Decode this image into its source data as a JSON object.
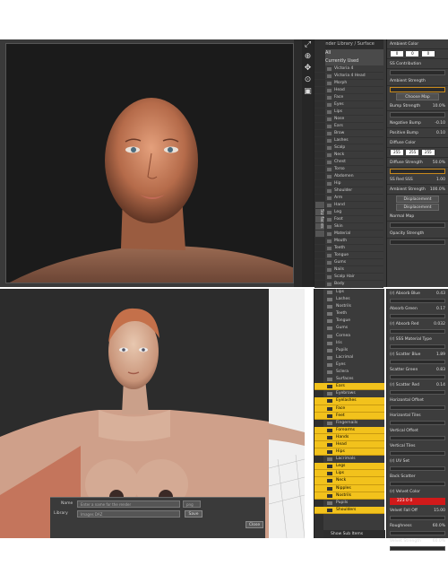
{
  "top": {
    "path": "Render Library / Surface",
    "tools": [
      "⤢",
      "⊕",
      "✥",
      "⊙",
      "▣"
    ],
    "library": {
      "header_all": "All",
      "header_recent": "Currently Used",
      "items": [
        "Victoria 4",
        "Victoria 4 Head",
        "Morph",
        "Head",
        "Face",
        "Eyes",
        "Lips",
        "Nose",
        "Ears",
        "Brow",
        "Lashes",
        "Scalp",
        "Neck",
        "Chest",
        "Torso",
        "Abdomen",
        "Hip",
        "Shoulder",
        "Arm",
        "Hand",
        "Leg",
        "Foot",
        "Skin",
        "Material",
        "Mouth",
        "Teeth",
        "Tongue",
        "Gums",
        "Nails",
        "Scalp Hair",
        "Body",
        "Lacrimal",
        "Cornea",
        "Pupil",
        "Iris",
        "Sclera",
        "Back",
        "Front",
        "Shared"
      ],
      "side_tab": "Surfaces"
    },
    "props": [
      {
        "label": "Ambient Color",
        "value": ""
      },
      {
        "label": "SS Contribution",
        "value": ""
      },
      {
        "label": "Ambient Strength",
        "value": ""
      },
      {
        "label": "Bump Strength",
        "value": "10.0%"
      },
      {
        "label": "Negative Bump",
        "value": "-0.10"
      },
      {
        "label": "Positive Bump",
        "value": "0.10"
      },
      {
        "label": "Diffuse Color",
        "value": ""
      },
      {
        "label": "Diffuse Strength",
        "value": "50.0%"
      },
      {
        "label": "SS Red SSS",
        "value": "1.00"
      },
      {
        "label": "Ambient Strength",
        "value": "100.0%"
      },
      {
        "label": "Displacement",
        "value": ""
      },
      {
        "label": "Displacement",
        "value": ""
      },
      {
        "label": "Normal Map",
        "value": ""
      },
      {
        "label": "Opacity Strength",
        "value": ""
      }
    ],
    "button_label": "Choose Map",
    "swatch_values": [
      "0",
      "0",
      "0"
    ],
    "diffuse_swatch": [
      "255",
      "255",
      "255"
    ]
  },
  "bottom": {
    "library": {
      "items": [
        {
          "label": "Lips",
          "hl": false
        },
        {
          "label": "Lashes",
          "hl": false
        },
        {
          "label": "Nostrils",
          "hl": false
        },
        {
          "label": "Teeth",
          "hl": false
        },
        {
          "label": "Tongue",
          "hl": false
        },
        {
          "label": "Gums",
          "hl": false
        },
        {
          "label": "Cornea",
          "hl": false
        },
        {
          "label": "Iris",
          "hl": false
        },
        {
          "label": "Pupils",
          "hl": false
        },
        {
          "label": "Lacrimal",
          "hl": false
        },
        {
          "label": "Eyes",
          "hl": false
        },
        {
          "label": "Sclera",
          "hl": false
        },
        {
          "label": "Surfaces",
          "hl": false
        },
        {
          "label": "Ears",
          "hl": true
        },
        {
          "label": "Eyebrows",
          "hl": false
        },
        {
          "label": "Eyelashes",
          "hl": true
        },
        {
          "label": "Face",
          "hl": true
        },
        {
          "label": "Feet",
          "hl": true
        },
        {
          "label": "Fingernails",
          "hl": false
        },
        {
          "label": "Forearms",
          "hl": true
        },
        {
          "label": "Hands",
          "hl": true
        },
        {
          "label": "Head",
          "hl": true
        },
        {
          "label": "Hips",
          "hl": true
        },
        {
          "label": "Lacrimals",
          "hl": false
        },
        {
          "label": "Legs",
          "hl": true
        },
        {
          "label": "Lips",
          "hl": true
        },
        {
          "label": "Neck",
          "hl": true
        },
        {
          "label": "Nipples",
          "hl": true
        },
        {
          "label": "Nostrils",
          "hl": true
        },
        {
          "label": "Pupils",
          "hl": false
        },
        {
          "label": "Shoulders",
          "hl": true
        }
      ],
      "footer": "Show Sub Items"
    },
    "props": [
      {
        "label": "(r) Absorb Blue",
        "value": "0.43"
      },
      {
        "label": "Absorb Green",
        "value": "0.17"
      },
      {
        "label": "(r) Absorb Red",
        "value": "0.032"
      },
      {
        "label": "(r) SSS Material Type",
        "value": ""
      },
      {
        "label": "(r) Scatter Blue",
        "value": "1.89"
      },
      {
        "label": "Scatter Green",
        "value": "0.83"
      },
      {
        "label": "(r) Scatter Red",
        "value": "0.14"
      },
      {
        "label": "Horizontal Offset",
        "value": ""
      },
      {
        "label": "Horizontal Tiles",
        "value": ""
      },
      {
        "label": "Vertical Offset",
        "value": ""
      },
      {
        "label": "Vertical Tiles",
        "value": ""
      },
      {
        "label": "(r) UV Set",
        "value": ""
      },
      {
        "label": "Back Scatter",
        "value": ""
      },
      {
        "label": "(r) Velvet Color",
        "value": ""
      },
      {
        "label": "Velvet Fall Off",
        "value": "15.00"
      },
      {
        "label": "Roughness",
        "value": "60.0%"
      },
      {
        "label": "Velvet Strength",
        "value": "60.0%"
      }
    ],
    "red_swatch": "223  0  0",
    "dialog": {
      "name_label": "Name",
      "name_placeholder": "Enter a name for the render",
      "format": "png",
      "library_label": "Library",
      "library_value": "Images DAZ",
      "save_label": "Save",
      "close_label": "Close"
    }
  }
}
